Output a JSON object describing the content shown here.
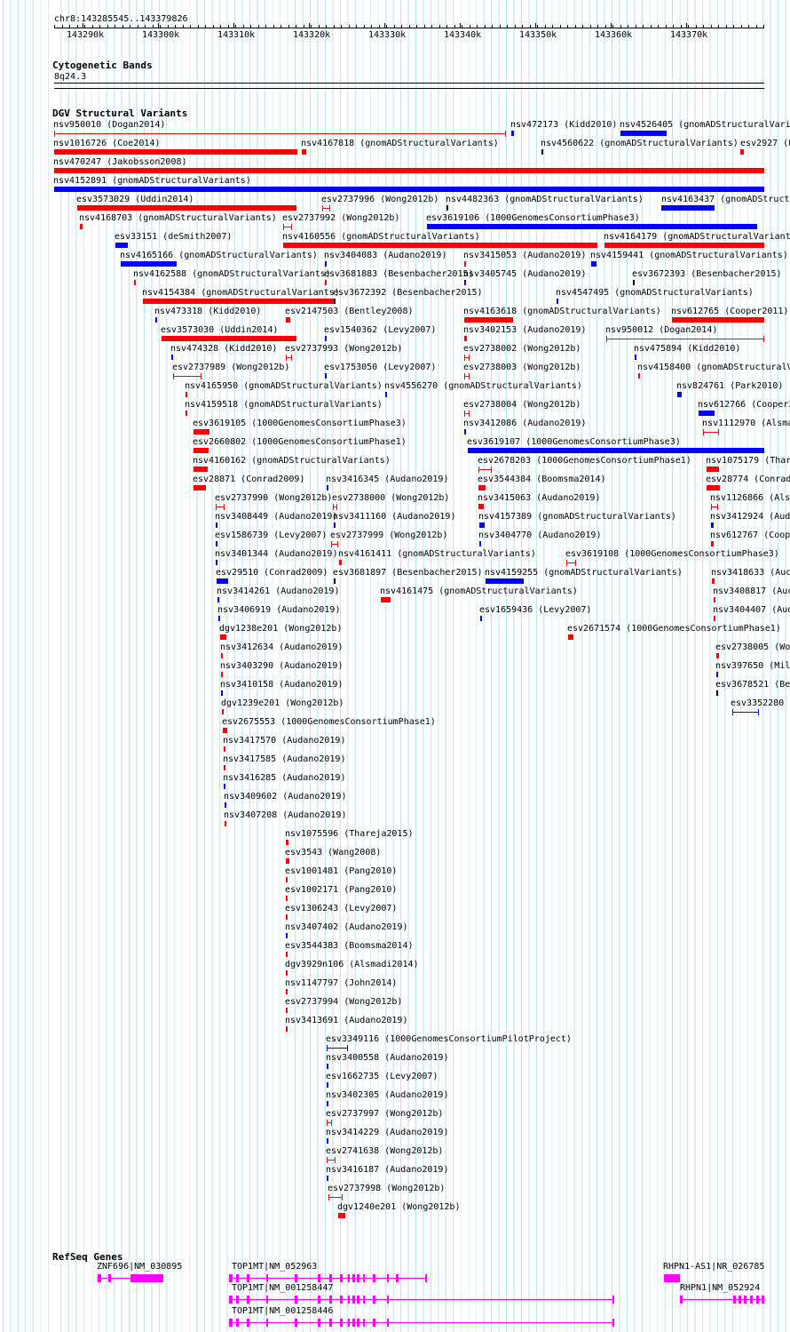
{
  "header": {
    "location": "chr8:143285545..143379826",
    "ruler_ticks": [
      "143290k",
      "143300k",
      "143310k",
      "143320k",
      "143330k",
      "143340k",
      "143350k",
      "143360k",
      "143370k"
    ]
  },
  "colors": {
    "loss": "#ff0000",
    "gain": "#0000ff",
    "neutral": "#000000",
    "gene": "#ff00ff",
    "grid": "#bfe0ee"
  },
  "cytoband": {
    "title": "Cytogenetic Bands",
    "band": "8q24.3"
  },
  "dgv": {
    "title": "DGV Structural Variants",
    "features": [
      {
        "label": "nsv950010 (Dogan2014)",
        "type": "loss",
        "style": "capped"
      },
      {
        "label": "nsv472173 (Kidd2010)",
        "type": "gain",
        "style": "solid"
      },
      {
        "label": "nsv4526405 (gnomADStructuralVariants)",
        "type": "gain",
        "style": "solid"
      },
      {
        "label": "nsv1016726 (Coe2014)",
        "type": "loss",
        "style": "solid"
      },
      {
        "label": "nsv4167818 (gnomADStructuralVariants)",
        "type": "loss",
        "style": "solid"
      },
      {
        "label": "nsv4560622 (gnomADStructuralVariants)",
        "type": "neutral",
        "style": "solid"
      },
      {
        "label": "esv2927 (Lo",
        "type": "loss",
        "style": "solid"
      },
      {
        "label": "nsv470247 (Jakobsson2008)",
        "type": "loss",
        "style": "solid"
      },
      {
        "label": "nsv4152891 (gnomADStructuralVariants)",
        "type": "gain",
        "style": "solid"
      },
      {
        "label": "esv3573029 (Uddin2014)",
        "type": "loss",
        "style": "solid"
      },
      {
        "label": "esv2737996 (Wong2012b)",
        "type": "loss",
        "style": "capped"
      },
      {
        "label": "nsv4482363 (gnomADStructuralVariants)",
        "type": "neutral",
        "style": "solid"
      },
      {
        "label": "nsv4163437 (gnomADStructu",
        "type": "gain",
        "style": "solid"
      },
      {
        "label": "nsv4168703 (gnomADStructuralVariants)",
        "type": "loss",
        "style": "solid"
      },
      {
        "label": "esv2737992 (Wong2012b)",
        "type": "loss",
        "style": "capped"
      },
      {
        "label": "esv3619106 (1000GenomesConsortiumPhase3)",
        "type": "gain",
        "style": "solid"
      },
      {
        "label": "esv33151 (deSmith2007)",
        "type": "gain",
        "style": "solid"
      },
      {
        "label": "nsv4160556 (gnomADStructuralVariants)",
        "type": "loss",
        "style": "solid"
      },
      {
        "label": "nsv4164179 (gnomADStructuralVariants)",
        "type": "loss",
        "style": "solid"
      },
      {
        "label": "nsv4165166 (gnomADStructuralVariants)",
        "type": "gain",
        "style": "solid"
      },
      {
        "label": "nsv3404083 (Audano2019)",
        "type": "gain",
        "style": "solid"
      },
      {
        "label": "nsv3415053 (Audano2019)",
        "type": "loss",
        "style": "solid"
      },
      {
        "label": "nsv4159441 (gnomADStructuralVariants)",
        "type": "gain",
        "style": "solid"
      },
      {
        "label": "nsv4162588 (gnomADStructuralVariants)",
        "type": "loss",
        "style": "solid"
      },
      {
        "label": "esv3681883 (Besenbacher2015)",
        "type": "loss",
        "style": "solid"
      },
      {
        "label": "nsv3405745 (Audano2019)",
        "type": "gain",
        "style": "solid"
      },
      {
        "label": "esv3672393 (Besenbacher2015)",
        "type": "neutral",
        "style": "solid"
      },
      {
        "label": "nsv4154384 (gnomADStructuralVariants)",
        "type": "loss",
        "style": "solid"
      },
      {
        "label": "esv3672392 (Besenbacher2015)",
        "type": "neutral",
        "style": "solid"
      },
      {
        "label": "nsv4547495 (gnomADStructuralVariants)",
        "type": "gain",
        "style": "solid"
      },
      {
        "label": "nsv473318 (Kidd2010)",
        "type": "gain",
        "style": "solid"
      },
      {
        "label": "esv2147503 (Bentley2008)",
        "type": "loss",
        "style": "solid"
      },
      {
        "label": "nsv4163618 (gnomADStructuralVariants)",
        "type": "loss",
        "style": "solid"
      },
      {
        "label": "nsv612765 (Cooper2011)",
        "type": "loss",
        "style": "solid"
      },
      {
        "label": "esv3573030 (Uddin2014)",
        "type": "loss",
        "style": "solid"
      },
      {
        "label": "esv1540362 (Levy2007)",
        "type": "gain",
        "style": "solid"
      },
      {
        "label": "nsv3402153 (Audano2019)",
        "type": "loss",
        "style": "solid"
      },
      {
        "label": "nsv950012 (Dogan2014)",
        "type": "loss",
        "style": "capped"
      },
      {
        "label": "nsv474328 (Kidd2010)",
        "type": "gain",
        "style": "solid"
      },
      {
        "label": "esv2737993 (Wong2012b)",
        "type": "loss",
        "style": "capped"
      },
      {
        "label": "esv2738002 (Wong2012b)",
        "type": "loss",
        "style": "capped"
      },
      {
        "label": "nsv475894 (Kidd2010)",
        "type": "gain",
        "style": "solid"
      },
      {
        "label": "esv2737989 (Wong2012b)",
        "type": "loss",
        "style": "capped"
      },
      {
        "label": "esv1753050 (Levy2007)",
        "type": "gain",
        "style": "solid"
      },
      {
        "label": "esv2738003 (Wong2012b)",
        "type": "loss",
        "style": "capped"
      },
      {
        "label": "nsv4158400 (gnomADStructuralVa",
        "type": "loss",
        "style": "solid"
      },
      {
        "label": "nsv4165950 (gnomADStructuralVariants)",
        "type": "loss",
        "style": "solid"
      },
      {
        "label": "nsv4556270 (gnomADStructuralVariants)",
        "type": "gain",
        "style": "solid"
      },
      {
        "label": "nsv824761 (Park2010)",
        "type": "gain",
        "style": "solid"
      },
      {
        "label": "nsv4159518 (gnomADStructuralVariants)",
        "type": "loss",
        "style": "solid"
      },
      {
        "label": "esv2738004 (Wong2012b)",
        "type": "loss",
        "style": "capped"
      },
      {
        "label": "nsv612766 (Cooper2",
        "type": "gain",
        "style": "solid"
      },
      {
        "label": "esv3619105 (1000GenomesConsortiumPhase3)",
        "type": "loss",
        "style": "solid"
      },
      {
        "label": "nsv3412086 (Audano2019)",
        "type": "gain",
        "style": "solid"
      },
      {
        "label": "nsv1112970 (Alsma",
        "type": "loss",
        "style": "capped"
      },
      {
        "label": "esv2660802 (1000GenomesConsortiumPhase1)",
        "type": "loss",
        "style": "solid"
      },
      {
        "label": "esv3619107 (1000GenomesConsortiumPhase3)",
        "type": "gain",
        "style": "solid"
      },
      {
        "label": "nsv4160162 (gnomADStructuralVariants)",
        "type": "loss",
        "style": "solid"
      },
      {
        "label": "esv2678203 (1000GenomesConsortiumPhase1)",
        "type": "loss",
        "style": "capped"
      },
      {
        "label": "nsv1075179 (Thar",
        "type": "loss",
        "style": "solid"
      },
      {
        "label": "esv28871 (Conrad2009)",
        "type": "loss",
        "style": "solid"
      },
      {
        "label": "nsv3416345 (Audano2019)",
        "type": "gain",
        "style": "solid"
      },
      {
        "label": "esv3544384 (Boomsma2014)",
        "type": "loss",
        "style": "solid"
      },
      {
        "label": "esv28774 (Conrad",
        "type": "loss",
        "style": "solid"
      },
      {
        "label": "esv2737990 (Wong2012b)",
        "type": "loss",
        "style": "capped"
      },
      {
        "label": "esv2738000 (Wong2012b)",
        "type": "loss",
        "style": "capped"
      },
      {
        "label": "nsv3415063 (Audano2019)",
        "type": "loss",
        "style": "solid"
      },
      {
        "label": "nsv1126866 (Als",
        "type": "loss",
        "style": "capped"
      },
      {
        "label": "nsv3408449 (Audano2019)",
        "type": "gain",
        "style": "solid"
      },
      {
        "label": "nsv3411160 (Audano2019)",
        "type": "gain",
        "style": "solid"
      },
      {
        "label": "nsv4157389 (gnomADStructuralVariants)",
        "type": "gain",
        "style": "solid"
      },
      {
        "label": "nsv3412924 (Aud",
        "type": "gain",
        "style": "solid"
      },
      {
        "label": "esv1586739 (Levy2007)",
        "type": "gain",
        "style": "solid"
      },
      {
        "label": "esv2737999 (Wong2012b)",
        "type": "loss",
        "style": "capped"
      },
      {
        "label": "nsv3404770 (Audano2019)",
        "type": "gain",
        "style": "solid"
      },
      {
        "label": "nsv612767 (Coop",
        "type": "loss",
        "style": "solid"
      },
      {
        "label": "nsv3401344 (Audano2019)",
        "type": "gain",
        "style": "solid"
      },
      {
        "label": "nsv4161411 (gnomADStructuralVariants)",
        "type": "loss",
        "style": "solid"
      },
      {
        "label": "esv3619108 (1000GenomesConsortiumPhase3)",
        "type": "loss",
        "style": "capped"
      },
      {
        "label": "esv29510 (Conrad2009)",
        "type": "gain",
        "style": "solid"
      },
      {
        "label": "esv3681897 (Besenbacher2015)",
        "type": "neutral",
        "style": "solid"
      },
      {
        "label": "nsv4159255 (gnomADStructuralVariants)",
        "type": "gain",
        "style": "solid"
      },
      {
        "label": "nsv3418633 (Auc",
        "type": "loss",
        "style": "solid"
      },
      {
        "label": "nsv3414261 (Audano2019)",
        "type": "gain",
        "style": "solid"
      },
      {
        "label": "nsv4161475 (gnomADStructuralVariants)",
        "type": "loss",
        "style": "solid"
      },
      {
        "label": "nsv3408817 (Auc",
        "type": "loss",
        "style": "solid"
      },
      {
        "label": "nsv3406919 (Audano2019)",
        "type": "gain",
        "style": "solid"
      },
      {
        "label": "esv1659436 (Levy2007)",
        "type": "gain",
        "style": "solid"
      },
      {
        "label": "nsv3404407 (Aud",
        "type": "loss",
        "style": "solid"
      },
      {
        "label": "dgv1238e201 (Wong2012b)",
        "type": "loss",
        "style": "solid"
      },
      {
        "label": "esv2671574 (1000GenomesConsortiumPhase1)",
        "type": "loss",
        "style": "solid"
      },
      {
        "label": "nsv3412634 (Audano2019)",
        "type": "loss",
        "style": "solid"
      },
      {
        "label": "esv2738005 (Wo",
        "type": "loss",
        "style": "solid"
      },
      {
        "label": "nsv3403290 (Audano2019)",
        "type": "loss",
        "style": "solid"
      },
      {
        "label": "nsv397650 (Mil",
        "type": "gain",
        "style": "solid"
      },
      {
        "label": "nsv3410158 (Audano2019)",
        "type": "gain",
        "style": "solid"
      },
      {
        "label": "esv3678521 (Be",
        "type": "neutral",
        "style": "solid"
      },
      {
        "label": "dgv1239e201 (Wong2012b)",
        "type": "loss",
        "style": "solid"
      },
      {
        "label": "esv3352280",
        "type": "gain",
        "style": "capped"
      },
      {
        "label": "esv2675553 (1000GenomesConsortiumPhase1)",
        "type": "loss",
        "style": "solid"
      },
      {
        "label": "nsv3417570 (Audano2019)",
        "type": "loss",
        "style": "solid"
      },
      {
        "label": "nsv3417585 (Audano2019)",
        "type": "loss",
        "style": "solid"
      },
      {
        "label": "nsv3416285 (Audano2019)",
        "type": "gain",
        "style": "solid"
      },
      {
        "label": "nsv3409602 (Audano2019)",
        "type": "gain",
        "style": "solid"
      },
      {
        "label": "nsv3407208 (Audano2019)",
        "type": "loss",
        "style": "solid"
      },
      {
        "label": "nsv1075596 (Thareja2015)",
        "type": "loss",
        "style": "solid"
      },
      {
        "label": "esv3543 (Wang2008)",
        "type": "loss",
        "style": "solid"
      },
      {
        "label": "esv1001481 (Pang2010)",
        "type": "loss",
        "style": "solid"
      },
      {
        "label": "esv1002171 (Pang2010)",
        "type": "loss",
        "style": "solid"
      },
      {
        "label": "esv1306243 (Levy2007)",
        "type": "loss",
        "style": "solid"
      },
      {
        "label": "nsv3407402 (Audano2019)",
        "type": "gain",
        "style": "solid"
      },
      {
        "label": "esv3544383 (Boomsma2014)",
        "type": "loss",
        "style": "solid"
      },
      {
        "label": "dgv3929n106 (Alsmadi2014)",
        "type": "loss",
        "style": "solid"
      },
      {
        "label": "nsv1147797 (John2014)",
        "type": "loss",
        "style": "solid"
      },
      {
        "label": "esv2737994 (Wong2012b)",
        "type": "loss",
        "style": "solid"
      },
      {
        "label": "nsv3413691 (Audano2019)",
        "type": "loss",
        "style": "solid"
      },
      {
        "label": "esv3349116 (1000GenomesConsortiumPilotProject)",
        "type": "gain",
        "style": "capped"
      },
      {
        "label": "nsv3400558 (Audano2019)",
        "type": "gain",
        "style": "solid"
      },
      {
        "label": "esv1662735 (Levy2007)",
        "type": "gain",
        "style": "solid"
      },
      {
        "label": "nsv3402305 (Audano2019)",
        "type": "gain",
        "style": "solid"
      },
      {
        "label": "esv2737997 (Wong2012b)",
        "type": "loss",
        "style": "capped"
      },
      {
        "label": "nsv3414229 (Audano2019)",
        "type": "gain",
        "style": "solid"
      },
      {
        "label": "esv2741638 (Wong2012b)",
        "type": "loss",
        "style": "capped"
      },
      {
        "label": "nsv3416187 (Audano2019)",
        "type": "gain",
        "style": "solid"
      },
      {
        "label": "esv2737998 (Wong2012b)",
        "type": "loss",
        "style": "capped"
      },
      {
        "label": "dgv1240e201 (Wong2012b)",
        "type": "loss",
        "style": "solid"
      }
    ]
  },
  "refseq": {
    "title": "RefSeq Genes",
    "genes": [
      {
        "label": "ZNF696|NM_030895"
      },
      {
        "label": "TOP1MT|NM_052963"
      },
      {
        "label": "TOP1MT|NM_001258447"
      },
      {
        "label": "TOP1MT|NM_001258446"
      },
      {
        "label": "RHPN1-AS1|NR_026785"
      },
      {
        "label": "RHPN1|NM_052924"
      }
    ]
  }
}
